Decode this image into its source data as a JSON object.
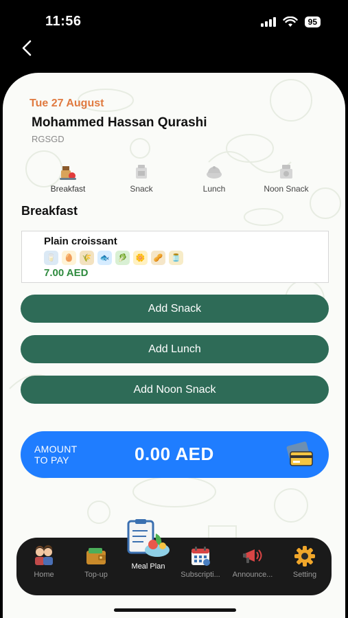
{
  "status_bar": {
    "time": "11:56",
    "battery": "95"
  },
  "header": {
    "date": "Tue 27 August",
    "name": "Mohammed Hassan Qurashi",
    "code": "RGSGD"
  },
  "meal_tabs": [
    {
      "label": "Breakfast",
      "icon": "breakfast-icon",
      "active": true
    },
    {
      "label": "Snack",
      "icon": "snack-icon",
      "active": false
    },
    {
      "label": "Lunch",
      "icon": "lunch-icon",
      "active": false
    },
    {
      "label": "Noon Snack",
      "icon": "noon-snack-icon",
      "active": false
    }
  ],
  "section": {
    "title": "Breakfast"
  },
  "item": {
    "name": "Plain croissant",
    "price": "7.00 AED",
    "allergens": [
      "milk-icon",
      "egg-icon",
      "wheat-icon",
      "fish-icon",
      "celery-icon",
      "mustard-icon",
      "peanut-icon",
      "sesame-icon"
    ]
  },
  "actions": {
    "add_snack": "Add Snack",
    "add_lunch": "Add Lunch",
    "add_noon_snack": "Add Noon Snack"
  },
  "amount": {
    "label_line1": "AMOUNT",
    "label_line2": "TO PAY",
    "value": "0.00 AED"
  },
  "nav": [
    {
      "label": "Home",
      "icon": "home-family-icon"
    },
    {
      "label": "Top-up",
      "icon": "wallet-icon"
    },
    {
      "label": "Meal Plan",
      "icon": "meal-plan-icon",
      "active": true
    },
    {
      "label": "Subscripti...",
      "icon": "calendar-icon"
    },
    {
      "label": "Announce...",
      "icon": "megaphone-icon"
    },
    {
      "label": "Setting",
      "icon": "gear-icon"
    }
  ],
  "colors": {
    "accent_green": "#2e6b57",
    "price_green": "#2e8a3e",
    "date_orange": "#e07a40",
    "amount_blue": "#1f7dff"
  }
}
